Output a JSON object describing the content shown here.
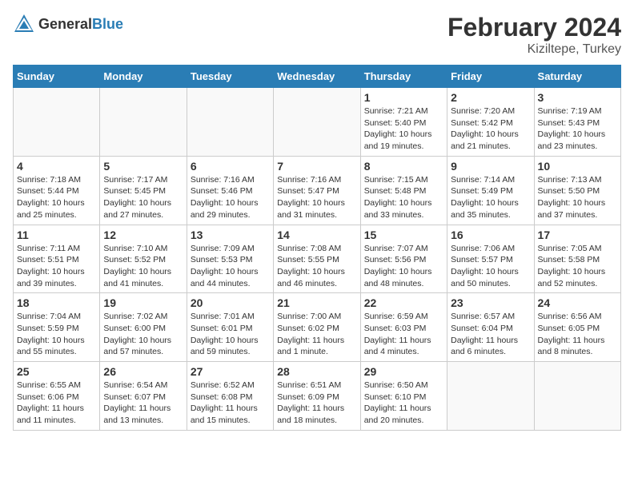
{
  "header": {
    "logo_general": "General",
    "logo_blue": "Blue",
    "title": "February 2024",
    "subtitle": "Kiziltepe, Turkey"
  },
  "weekdays": [
    "Sunday",
    "Monday",
    "Tuesday",
    "Wednesday",
    "Thursday",
    "Friday",
    "Saturday"
  ],
  "weeks": [
    [
      {
        "day": "",
        "info": ""
      },
      {
        "day": "",
        "info": ""
      },
      {
        "day": "",
        "info": ""
      },
      {
        "day": "",
        "info": ""
      },
      {
        "day": "1",
        "info": "Sunrise: 7:21 AM\nSunset: 5:40 PM\nDaylight: 10 hours\nand 19 minutes."
      },
      {
        "day": "2",
        "info": "Sunrise: 7:20 AM\nSunset: 5:42 PM\nDaylight: 10 hours\nand 21 minutes."
      },
      {
        "day": "3",
        "info": "Sunrise: 7:19 AM\nSunset: 5:43 PM\nDaylight: 10 hours\nand 23 minutes."
      }
    ],
    [
      {
        "day": "4",
        "info": "Sunrise: 7:18 AM\nSunset: 5:44 PM\nDaylight: 10 hours\nand 25 minutes."
      },
      {
        "day": "5",
        "info": "Sunrise: 7:17 AM\nSunset: 5:45 PM\nDaylight: 10 hours\nand 27 minutes."
      },
      {
        "day": "6",
        "info": "Sunrise: 7:16 AM\nSunset: 5:46 PM\nDaylight: 10 hours\nand 29 minutes."
      },
      {
        "day": "7",
        "info": "Sunrise: 7:16 AM\nSunset: 5:47 PM\nDaylight: 10 hours\nand 31 minutes."
      },
      {
        "day": "8",
        "info": "Sunrise: 7:15 AM\nSunset: 5:48 PM\nDaylight: 10 hours\nand 33 minutes."
      },
      {
        "day": "9",
        "info": "Sunrise: 7:14 AM\nSunset: 5:49 PM\nDaylight: 10 hours\nand 35 minutes."
      },
      {
        "day": "10",
        "info": "Sunrise: 7:13 AM\nSunset: 5:50 PM\nDaylight: 10 hours\nand 37 minutes."
      }
    ],
    [
      {
        "day": "11",
        "info": "Sunrise: 7:11 AM\nSunset: 5:51 PM\nDaylight: 10 hours\nand 39 minutes."
      },
      {
        "day": "12",
        "info": "Sunrise: 7:10 AM\nSunset: 5:52 PM\nDaylight: 10 hours\nand 41 minutes."
      },
      {
        "day": "13",
        "info": "Sunrise: 7:09 AM\nSunset: 5:53 PM\nDaylight: 10 hours\nand 44 minutes."
      },
      {
        "day": "14",
        "info": "Sunrise: 7:08 AM\nSunset: 5:55 PM\nDaylight: 10 hours\nand 46 minutes."
      },
      {
        "day": "15",
        "info": "Sunrise: 7:07 AM\nSunset: 5:56 PM\nDaylight: 10 hours\nand 48 minutes."
      },
      {
        "day": "16",
        "info": "Sunrise: 7:06 AM\nSunset: 5:57 PM\nDaylight: 10 hours\nand 50 minutes."
      },
      {
        "day": "17",
        "info": "Sunrise: 7:05 AM\nSunset: 5:58 PM\nDaylight: 10 hours\nand 52 minutes."
      }
    ],
    [
      {
        "day": "18",
        "info": "Sunrise: 7:04 AM\nSunset: 5:59 PM\nDaylight: 10 hours\nand 55 minutes."
      },
      {
        "day": "19",
        "info": "Sunrise: 7:02 AM\nSunset: 6:00 PM\nDaylight: 10 hours\nand 57 minutes."
      },
      {
        "day": "20",
        "info": "Sunrise: 7:01 AM\nSunset: 6:01 PM\nDaylight: 10 hours\nand 59 minutes."
      },
      {
        "day": "21",
        "info": "Sunrise: 7:00 AM\nSunset: 6:02 PM\nDaylight: 11 hours\nand 1 minute."
      },
      {
        "day": "22",
        "info": "Sunrise: 6:59 AM\nSunset: 6:03 PM\nDaylight: 11 hours\nand 4 minutes."
      },
      {
        "day": "23",
        "info": "Sunrise: 6:57 AM\nSunset: 6:04 PM\nDaylight: 11 hours\nand 6 minutes."
      },
      {
        "day": "24",
        "info": "Sunrise: 6:56 AM\nSunset: 6:05 PM\nDaylight: 11 hours\nand 8 minutes."
      }
    ],
    [
      {
        "day": "25",
        "info": "Sunrise: 6:55 AM\nSunset: 6:06 PM\nDaylight: 11 hours\nand 11 minutes."
      },
      {
        "day": "26",
        "info": "Sunrise: 6:54 AM\nSunset: 6:07 PM\nDaylight: 11 hours\nand 13 minutes."
      },
      {
        "day": "27",
        "info": "Sunrise: 6:52 AM\nSunset: 6:08 PM\nDaylight: 11 hours\nand 15 minutes."
      },
      {
        "day": "28",
        "info": "Sunrise: 6:51 AM\nSunset: 6:09 PM\nDaylight: 11 hours\nand 18 minutes."
      },
      {
        "day": "29",
        "info": "Sunrise: 6:50 AM\nSunset: 6:10 PM\nDaylight: 11 hours\nand 20 minutes."
      },
      {
        "day": "",
        "info": ""
      },
      {
        "day": "",
        "info": ""
      }
    ]
  ]
}
